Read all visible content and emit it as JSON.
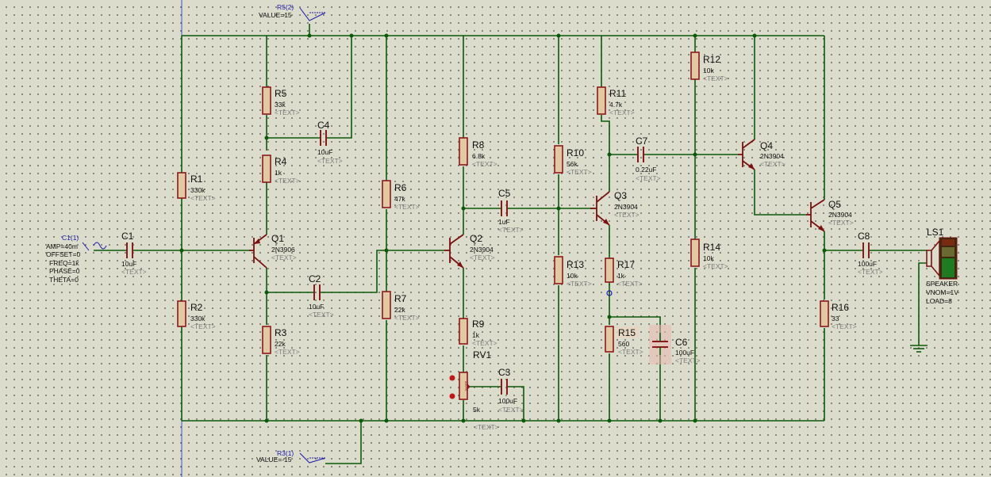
{
  "components": {
    "R5_2": {
      "ref": "R5(2)",
      "value": "VALUE=15"
    },
    "R3_1": {
      "ref": "R3(1)",
      "value": "VALUE=-15"
    },
    "C1_1": {
      "ref": "C1(1)",
      "params": [
        "AMP=40m",
        "OFFSET=0",
        "FREQ=1k",
        "PHASE=0",
        "THETA=0"
      ]
    },
    "C1": {
      "ref": "C1",
      "value": "10uF",
      "text": "<TEXT>"
    },
    "R1": {
      "ref": "R1",
      "value": "330k",
      "text": "<TEXT>"
    },
    "R2": {
      "ref": "R2",
      "value": "330k",
      "text": "<TEXT>"
    },
    "R3": {
      "ref": "R3",
      "value": "22k",
      "text": "<TEXT>"
    },
    "R4": {
      "ref": "R4",
      "value": "1k",
      "text": "<TEXT>"
    },
    "R5": {
      "ref": "R5",
      "value": "33k",
      "text": "<TEXT>"
    },
    "C4": {
      "ref": "C4",
      "value": "10uF",
      "text": "<TEXT>"
    },
    "Q1": {
      "ref": "Q1",
      "value": "2N3906",
      "text": "<TEXT>"
    },
    "C2": {
      "ref": "C2",
      "value": "10uF",
      "text": "<TEXT>"
    },
    "R6": {
      "ref": "R6",
      "value": "47k",
      "text": "<TEXT>"
    },
    "R7": {
      "ref": "R7",
      "value": "22k",
      "text": "<TEXT>"
    },
    "Q2": {
      "ref": "Q2",
      "value": "2N3904",
      "text": "<TEXT>"
    },
    "R8": {
      "ref": "R8",
      "value": "6.8k",
      "text": "<TEXT>"
    },
    "R9": {
      "ref": "R9",
      "value": "1k",
      "text": "<TEXT>"
    },
    "RV1": {
      "ref": "RV1",
      "value": "5k",
      "text": "<TEXT>",
      "wiper": "100%"
    },
    "C3": {
      "ref": "C3",
      "value": "100uF",
      "text": "<TEXT>"
    },
    "C5": {
      "ref": "C5",
      "value": "1uF",
      "text": "<TEXT>"
    },
    "R10": {
      "ref": "R10",
      "value": "56k",
      "text": "<TEXT>"
    },
    "R13": {
      "ref": "R13",
      "value": "10k",
      "text": "<TEXT>"
    },
    "R11": {
      "ref": "R11",
      "value": "4.7k",
      "text": "<TEXT>"
    },
    "Q3": {
      "ref": "Q3",
      "value": "2N3904",
      "text": "<TEXT>"
    },
    "R17": {
      "ref": "R17",
      "value": "1k",
      "text": "<TEXT>"
    },
    "R15": {
      "ref": "R15",
      "value": "560",
      "text": "<TEXT>"
    },
    "C6": {
      "ref": "C6",
      "value": "100uF",
      "text": "<TEXT>"
    },
    "C7": {
      "ref": "C7",
      "value": "0.22uF",
      "text": "<TEXT>"
    },
    "R12": {
      "ref": "R12",
      "value": "10k",
      "text": "<TEXT>"
    },
    "R14": {
      "ref": "R14",
      "value": "10k",
      "text": "<TEXT>"
    },
    "Q4": {
      "ref": "Q4",
      "value": "2N3904",
      "text": "<TEXT>"
    },
    "Q5": {
      "ref": "Q5",
      "value": "2N3904",
      "text": "<TEXT>"
    },
    "C8": {
      "ref": "C8",
      "value": "100uF",
      "text": "<TEXT>"
    },
    "R16": {
      "ref": "R16",
      "value": "33",
      "text": "<TEXT>"
    },
    "LS1": {
      "ref": "LS1",
      "params": [
        "SPEAKER",
        "VNOM=1V",
        "LOAD=8"
      ]
    }
  },
  "colors": {
    "background": "#dcdccc",
    "wire": "#0b5a0b",
    "component": "#8a1a1a",
    "resistor_fill": "#e2c9a3",
    "label_ref": "#1a1ab0"
  }
}
